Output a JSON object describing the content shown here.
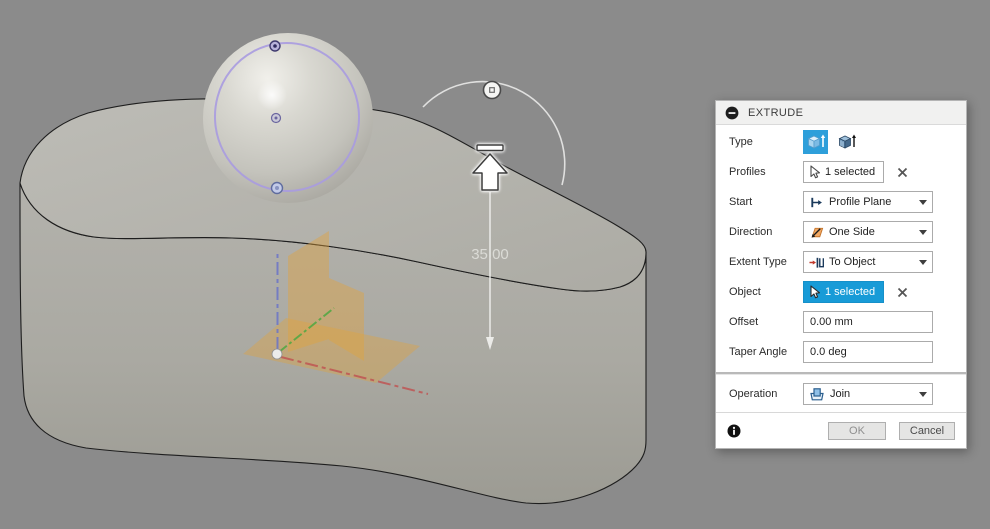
{
  "viewport": {
    "dimension_value": "35.00"
  },
  "dialog": {
    "title": "EXTRUDE",
    "type": {
      "label": "Type"
    },
    "profiles": {
      "label": "Profiles",
      "value": "1 selected"
    },
    "start": {
      "label": "Start",
      "value": "Profile Plane"
    },
    "direction": {
      "label": "Direction",
      "value": "One Side"
    },
    "extent_type": {
      "label": "Extent Type",
      "value": "To Object"
    },
    "object": {
      "label": "Object",
      "value": "1 selected"
    },
    "offset": {
      "label": "Offset",
      "value": "0.00 mm"
    },
    "taper_angle": {
      "label": "Taper Angle",
      "value": "0.0 deg"
    },
    "operation": {
      "label": "Operation",
      "value": "Join"
    },
    "ok_label": "OK",
    "cancel_label": "Cancel"
  },
  "colors": {
    "viewport_background": "#8B8B8B",
    "selection_blue": "#189BD7",
    "type_selected_blue": "#2E9FDA",
    "construction_plane_orange": "#E2A23B",
    "profile_edge_purple": "#A89BE0",
    "axis_x_red": "#C05050",
    "axis_y_green": "#55A845",
    "axis_z_blue": "#6B74C8"
  }
}
